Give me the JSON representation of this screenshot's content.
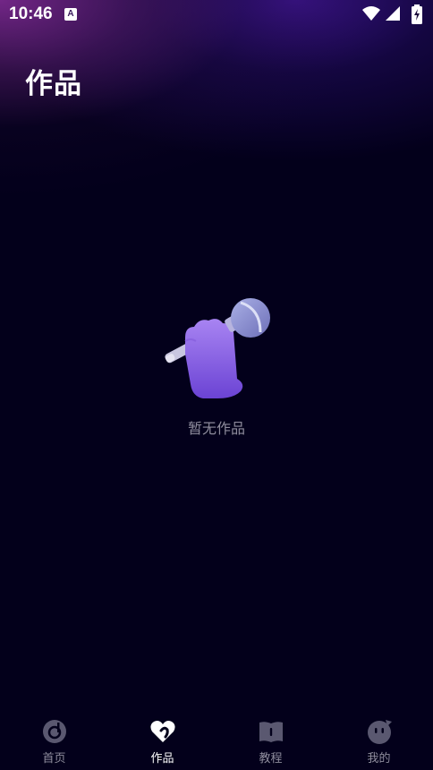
{
  "status_bar": {
    "time": "10:46",
    "notification_glyph": "A",
    "icons": [
      "wifi-icon",
      "signal-icon",
      "battery-charging-icon"
    ]
  },
  "page": {
    "title": "作品"
  },
  "empty_state": {
    "icon": "microphone-in-hand-icon",
    "text": "暂无作品"
  },
  "tabbar": {
    "active_tab": "作品",
    "items": [
      {
        "label": "首页",
        "icon": "music-disc-icon"
      },
      {
        "label": "作品",
        "icon": "heart-icon"
      },
      {
        "label": "教程",
        "icon": "book-icon"
      },
      {
        "label": "我的",
        "icon": "profile-face-icon"
      }
    ]
  },
  "colors": {
    "background": "#03001b",
    "glow_purple": "#782c8c",
    "glow_indigo": "#3c148c",
    "text_muted": "#8e8c9c",
    "mic_purple": "#9b6ff0",
    "icon_inactive": "#5a5870"
  }
}
